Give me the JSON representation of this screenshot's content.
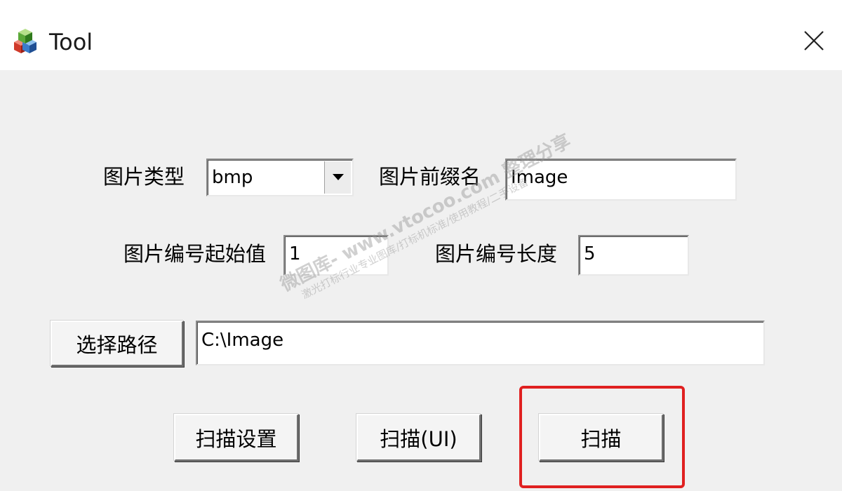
{
  "window": {
    "title": "Tool",
    "close_glyph": "✕"
  },
  "form": {
    "image_type_label": "图片类型",
    "image_type_value": "bmp",
    "image_prefix_label": "图片前缀名",
    "image_prefix_value": "Image",
    "start_number_label": "图片编号起始值",
    "start_number_value": "1",
    "number_length_label": "图片编号长度",
    "number_length_value": "5",
    "select_path_label": "选择路径",
    "path_value": "C:\\Image"
  },
  "buttons": {
    "scan_settings": "扫描设置",
    "scan_ui": "扫描(UI)",
    "scan": "扫描"
  },
  "watermark": {
    "main": "微图库- www.vtocoo.com 整理分享",
    "sub": "激光打标行业专业图库/打标机标准/使用教程/二手设备"
  },
  "colors": {
    "highlight": "#e02020",
    "window_bg": "#f0f0f0"
  }
}
